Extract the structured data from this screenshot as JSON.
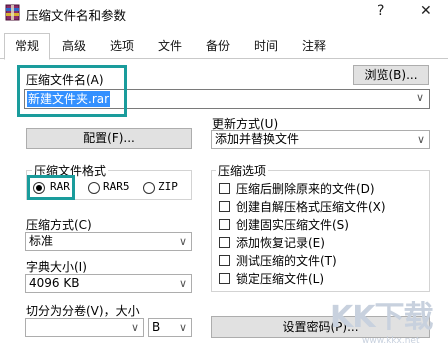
{
  "window": {
    "title": "压缩文件名和参数",
    "help_glyph": "?",
    "close_glyph": "✕"
  },
  "tabs": [
    {
      "label": "常规"
    },
    {
      "label": "高级"
    },
    {
      "label": "选项"
    },
    {
      "label": "文件"
    },
    {
      "label": "备份"
    },
    {
      "label": "时间"
    },
    {
      "label": "注释"
    }
  ],
  "archive": {
    "name_label": "压缩文件名(A)",
    "name_value": "新建文件夹.rar",
    "browse_label": "浏览(B)..."
  },
  "profile": {
    "button_label": "配置(F)..."
  },
  "update": {
    "label": "更新方式(U)",
    "value": "添加并替换文件"
  },
  "format": {
    "title": "压缩文件格式",
    "options": [
      {
        "label": "RAR",
        "selected": true
      },
      {
        "label": "RAR5",
        "selected": false
      },
      {
        "label": "ZIP",
        "selected": false
      }
    ]
  },
  "method": {
    "label": "压缩方式(C)",
    "value": "标准"
  },
  "dictionary": {
    "label": "字典大小(I)",
    "value": "4096 KB"
  },
  "split": {
    "label": "切分为分卷(V)，大小",
    "value": "",
    "unit": "B"
  },
  "options": {
    "title": "压缩选项",
    "items": [
      {
        "label": "压缩后删除原来的文件(D)",
        "checked": false
      },
      {
        "label": "创建自解压格式压缩文件(X)",
        "checked": false
      },
      {
        "label": "创建固实压缩文件(S)",
        "checked": false
      },
      {
        "label": "添加恢复记录(E)",
        "checked": false
      },
      {
        "label": "测试压缩的文件(T)",
        "checked": false
      },
      {
        "label": "锁定压缩文件(L)",
        "checked": false
      }
    ]
  },
  "password": {
    "button_label": "设置密码(P)..."
  },
  "watermark": {
    "logo_text": "KK下载",
    "url": "www.kkx.net"
  },
  "colors": {
    "highlight": "#1a9c9c",
    "selection": "#3390ff"
  },
  "icons": [
    "winrar-icon",
    "help-icon",
    "close-icon",
    "chevron-down-icon"
  ]
}
